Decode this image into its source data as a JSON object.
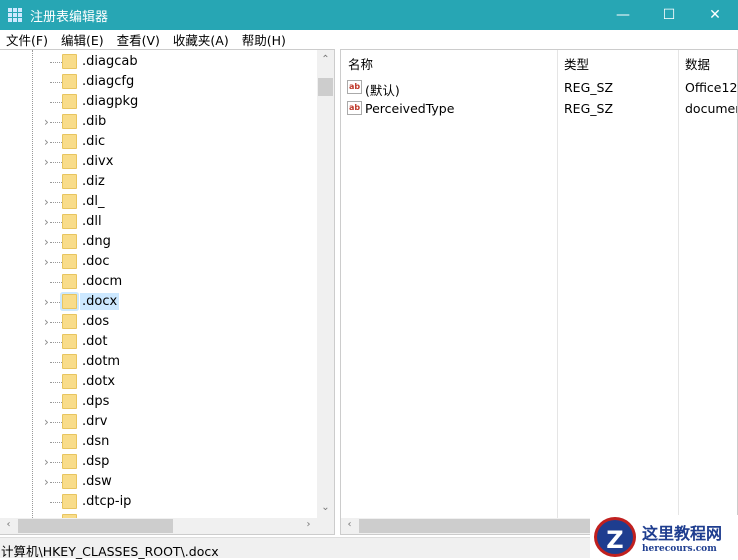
{
  "window": {
    "title": "注册表编辑器",
    "minimize": "—",
    "maximize": "☐",
    "close": "✕"
  },
  "menu": [
    "文件(F)",
    "编辑(E)",
    "查看(V)",
    "收藏夹(A)",
    "帮助(H)"
  ],
  "tree": {
    "items": [
      {
        "label": ".diagcab",
        "expandable": false
      },
      {
        "label": ".diagcfg",
        "expandable": false
      },
      {
        "label": ".diagpkg",
        "expandable": false
      },
      {
        "label": ".dib",
        "expandable": true
      },
      {
        "label": ".dic",
        "expandable": true
      },
      {
        "label": ".divx",
        "expandable": true
      },
      {
        "label": ".diz",
        "expandable": false
      },
      {
        "label": ".dl_",
        "expandable": true
      },
      {
        "label": ".dll",
        "expandable": true
      },
      {
        "label": ".dng",
        "expandable": true
      },
      {
        "label": ".doc",
        "expandable": true
      },
      {
        "label": ".docm",
        "expandable": false
      },
      {
        "label": ".docx",
        "expandable": true,
        "selected": true
      },
      {
        "label": ".dos",
        "expandable": true
      },
      {
        "label": ".dot",
        "expandable": true
      },
      {
        "label": ".dotm",
        "expandable": false
      },
      {
        "label": ".dotx",
        "expandable": false
      },
      {
        "label": ".dps",
        "expandable": false
      },
      {
        "label": ".drv",
        "expandable": true
      },
      {
        "label": ".dsn",
        "expandable": false
      },
      {
        "label": ".dsp",
        "expandable": true
      },
      {
        "label": ".dsw",
        "expandable": true
      },
      {
        "label": ".dtcp-ip",
        "expandable": false
      }
    ]
  },
  "list": {
    "columns": [
      "名称",
      "类型",
      "数据"
    ],
    "rows": [
      {
        "name": "(默认)",
        "type": "REG_SZ",
        "data": "Office12.",
        "icon": "ab"
      },
      {
        "name": "PerceivedType",
        "type": "REG_SZ",
        "data": "documer",
        "icon": "ab"
      }
    ]
  },
  "status": "计算机\\HKEY_CLASSES_ROOT\\.docx",
  "watermark": {
    "logo": "Z",
    "title": "这里教程网",
    "url": "herecours.com"
  }
}
